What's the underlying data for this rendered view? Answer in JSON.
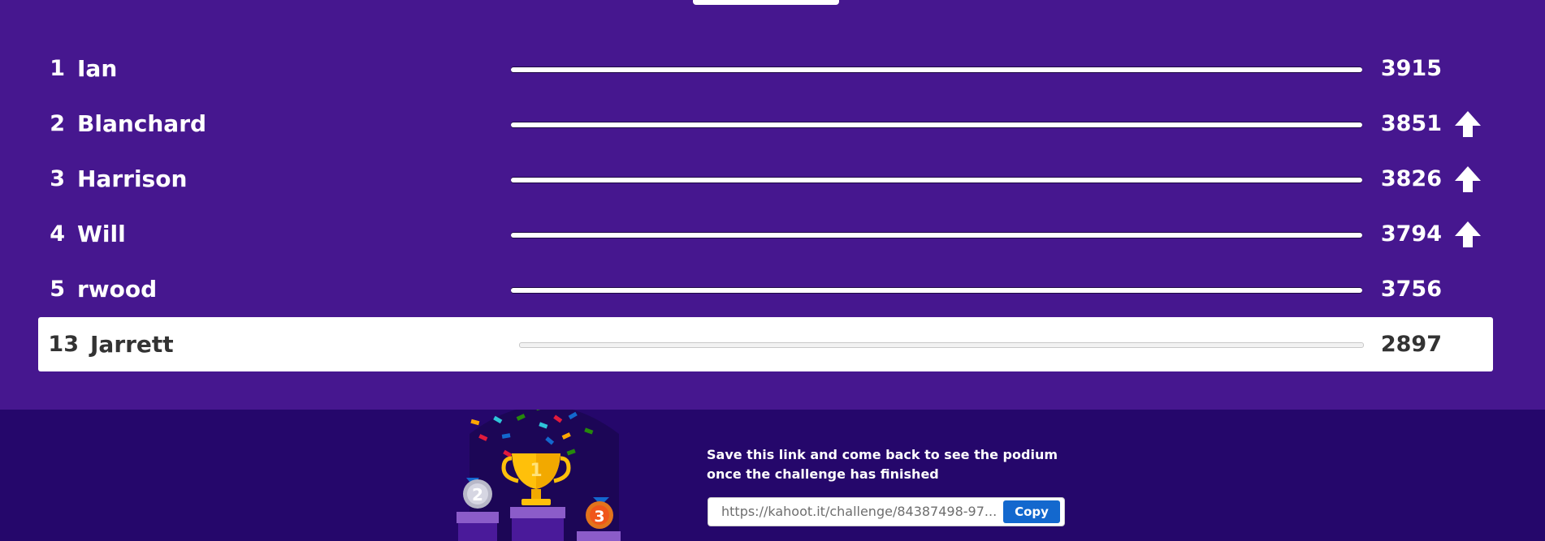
{
  "leaderboard": {
    "rows": [
      {
        "rank": "1",
        "name": "Ian",
        "score": "3915",
        "moved_up": false
      },
      {
        "rank": "2",
        "name": "Blanchard",
        "score": "3851",
        "moved_up": true
      },
      {
        "rank": "3",
        "name": "Harrison",
        "score": "3826",
        "moved_up": true
      },
      {
        "rank": "4",
        "name": "Will",
        "score": "3794",
        "moved_up": true
      },
      {
        "rank": "5",
        "name": "rwood",
        "score": "3756",
        "moved_up": false
      }
    ],
    "current_player": {
      "rank": "13",
      "name": "Jarrett",
      "score": "2897"
    }
  },
  "footer": {
    "save_text_line1": "Save this link and come back to see the podium",
    "save_text_line2": "once the challenge has finished",
    "link_value": "https://kahoot.it/challenge/84387498-97...",
    "copy_label": "Copy",
    "podium_labels": [
      "1",
      "2",
      "3"
    ]
  },
  "colors": {
    "background": "#46178f",
    "footer_bg": "#25076b",
    "copy_button": "#1368ce"
  },
  "icons": [
    "up-arrow-icon",
    "trophy-icon",
    "silver-medal-icon",
    "bronze-medal-icon",
    "confetti-icon"
  ]
}
